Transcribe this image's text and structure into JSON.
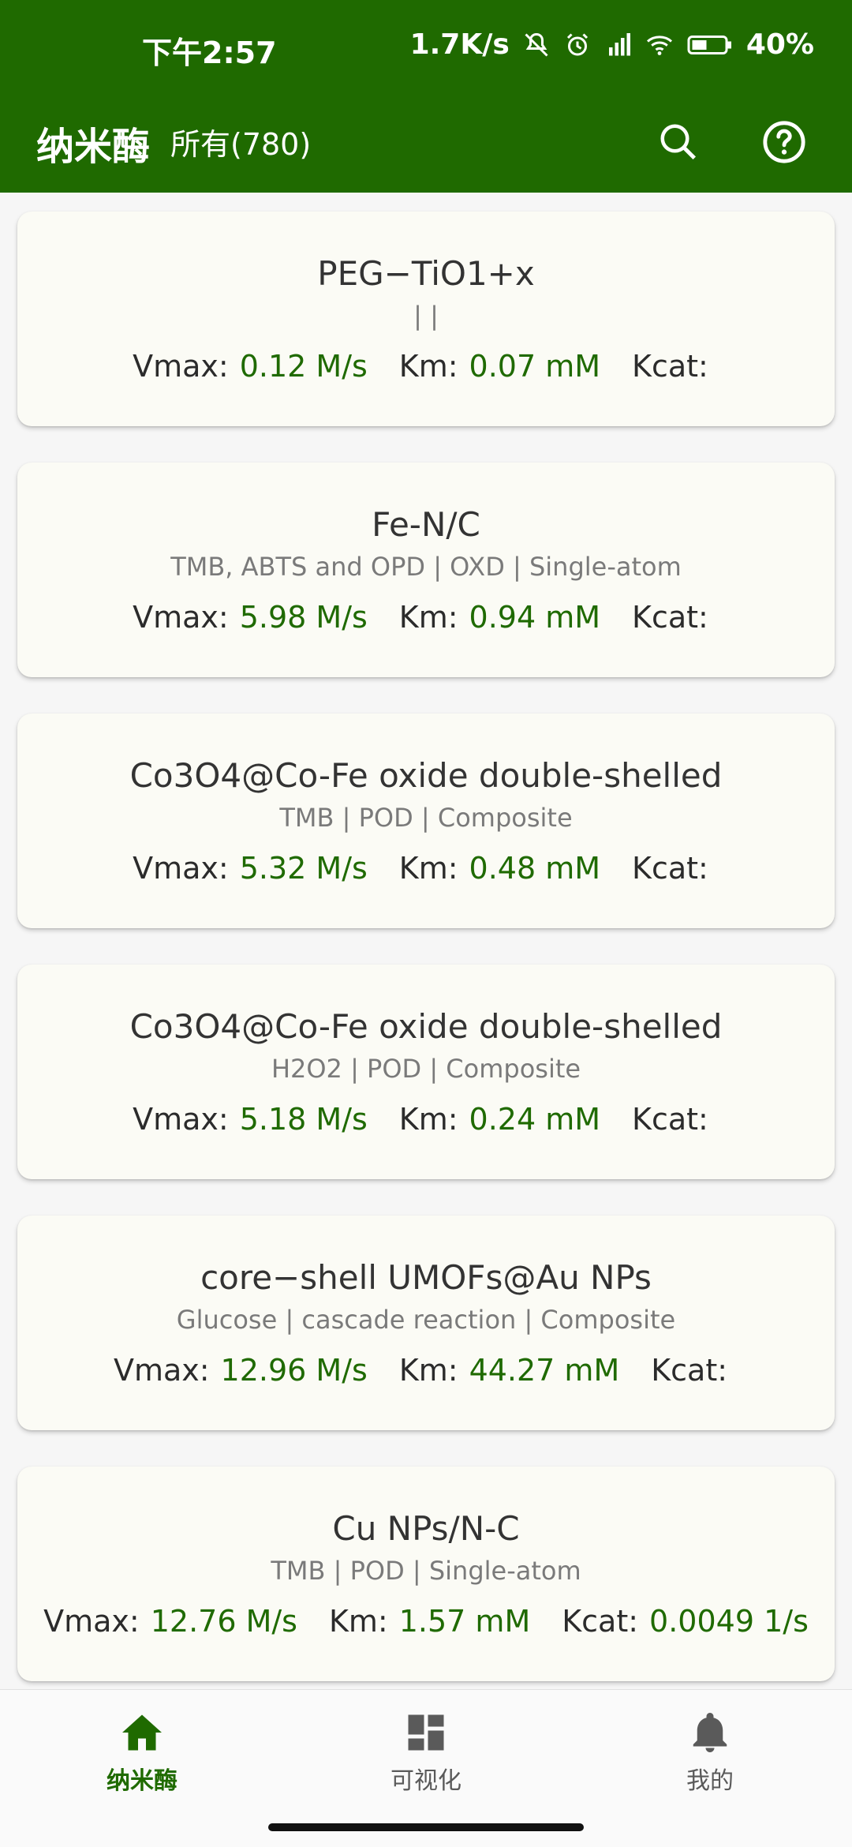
{
  "status_bar": {
    "time": "下午2:57",
    "network_speed": "1.7K/s",
    "battery": "40%",
    "icons": [
      "mute-icon",
      "alarm-icon",
      "signal-icon",
      "wifi-icon",
      "battery-icon"
    ]
  },
  "app_bar": {
    "title": "纳米酶",
    "subtitle": "所有(780)",
    "actions": [
      "search-icon",
      "help-icon"
    ]
  },
  "cards": [
    {
      "title": "PEG−TiO1+x",
      "tags": "| |",
      "vmax_label": "Vmax:",
      "vmax": "0.12 M/s",
      "km_label": "Km:",
      "km": "0.07 mM",
      "kcat_label": "Kcat:",
      "kcat": ""
    },
    {
      "title": "Fe-N/C",
      "tags": "TMB, ABTS and OPD | OXD | Single-atom",
      "vmax_label": "Vmax:",
      "vmax": "5.98 M/s",
      "km_label": "Km:",
      "km": "0.94 mM",
      "kcat_label": "Kcat:",
      "kcat": ""
    },
    {
      "title": "Co3O4@Co-Fe oxide double-shelled",
      "tags": "TMB | POD | Composite",
      "vmax_label": "Vmax:",
      "vmax": "5.32 M/s",
      "km_label": "Km:",
      "km": "0.48 mM",
      "kcat_label": "Kcat:",
      "kcat": ""
    },
    {
      "title": "Co3O4@Co-Fe oxide double-shelled",
      "tags": "H2O2 | POD | Composite",
      "vmax_label": "Vmax:",
      "vmax": "5.18 M/s",
      "km_label": "Km:",
      "km": "0.24 mM",
      "kcat_label": "Kcat:",
      "kcat": ""
    },
    {
      "title": "core−shell UMOFs@Au NPs",
      "tags": "Glucose | cascade reaction | Composite",
      "vmax_label": "Vmax:",
      "vmax": "12.96 M/s",
      "km_label": "Km:",
      "km": "44.27 mM",
      "kcat_label": "Kcat:",
      "kcat": ""
    },
    {
      "title": "Cu NPs/N-C",
      "tags": "TMB | POD | Single-atom",
      "vmax_label": "Vmax:",
      "vmax": "12.76 M/s",
      "km_label": "Km:",
      "km": "1.57 mM",
      "kcat_label": "Kcat:",
      "kcat": "0.0049 1/s"
    }
  ],
  "bottom_nav": [
    {
      "label": "纳米酶",
      "icon": "home-icon",
      "active": true
    },
    {
      "label": "可视化",
      "icon": "dashboard-icon",
      "active": false
    },
    {
      "label": "我的",
      "icon": "bell-icon",
      "active": false
    }
  ],
  "colors": {
    "primary": "#1f6a00",
    "card_bg": "#fbfbf5",
    "value_green": "#1f6a00"
  }
}
